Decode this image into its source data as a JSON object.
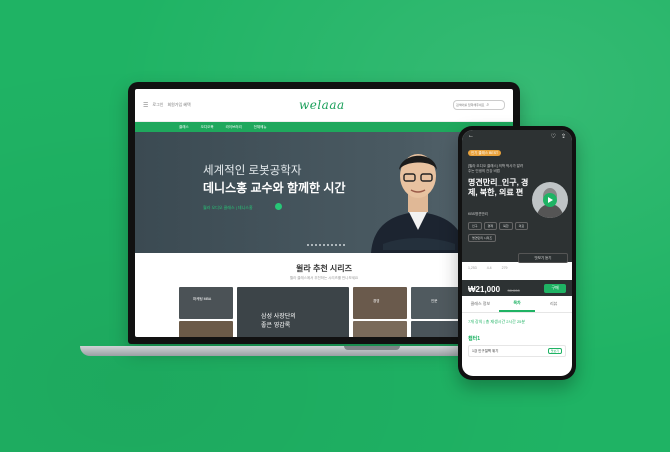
{
  "colors": {
    "background": "#1fb364",
    "accent": "#1fa85d",
    "dark": "#2d3233"
  },
  "laptop": {
    "topbar": {
      "left_small": "로그인",
      "left_small2": "회원가입 혜택",
      "logo": "welaaa",
      "search_placeholder": "검색어를 입력해주세요"
    },
    "nav": {
      "items": [
        "클래스",
        "오디오북",
        "라이브러리",
        "전체메뉴"
      ]
    },
    "hero": {
      "subtitle": "세계적인 로봇공학자",
      "title": "데니스홍 교수와 함께한 시간",
      "note": "월라 오디오 클래스 | 데니스홍"
    },
    "section": {
      "title": "윌라 추천 시리즈",
      "subtitle": "월라 클래스에서 추천하는 시리즈를 만나보세요"
    },
    "cards": [
      {
        "label": "마케팅 MBA"
      },
      {
        "label": "삼성 사장단의\n좋은 영감록"
      },
      {
        "label": "경영"
      },
      {
        "label": "인문"
      }
    ]
  },
  "phone": {
    "badge": "인기 클래스 BEST",
    "desc": "[윌라 오디오 클래스] 의학 박사가 알려주는 인생의 건강 비법",
    "title": "명견만리_인구, 경제, 북한, 의료 편",
    "author": "KBS명견만리",
    "tags": [
      "인구",
      "경제",
      "북한",
      "의료",
      "명견만리 시리즈"
    ],
    "sample_button": "맛보기 듣기",
    "stats": [
      "1,253",
      "4.4",
      "279"
    ],
    "price": "₩21,000",
    "original_price": "30,000",
    "buy_label": "구매",
    "tabs": [
      "클래스 정보",
      "목차",
      "리뷰"
    ],
    "tab_active": "목차",
    "progress_note": "7개 강의 | 총 재생시간 2시간 25분",
    "section_label": "챕터1",
    "chapter": {
      "title": "1강 인구절벽 위기",
      "tag": "맛보기"
    }
  }
}
